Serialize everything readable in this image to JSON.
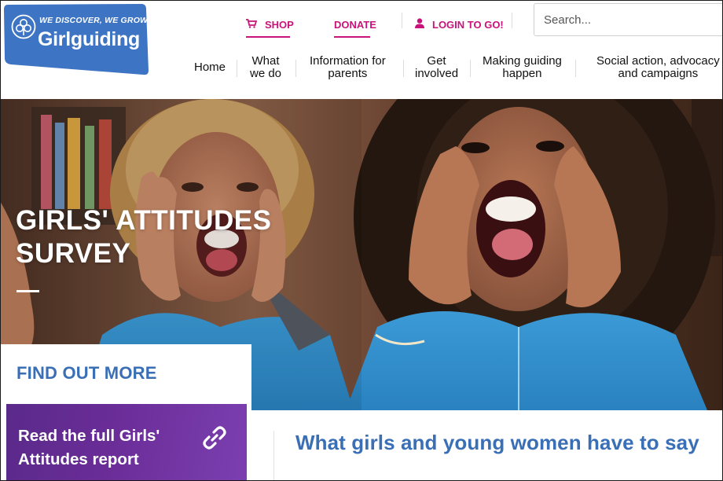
{
  "brand": {
    "tagline": "WE DISCOVER, WE GROW",
    "name": "Girlguiding",
    "color": "#3e74c4"
  },
  "utility_nav": {
    "shop_label": "SHOP",
    "donate_label": "DONATE",
    "login_label": "LOGIN TO GO!",
    "accent_color": "#c8137a",
    "shop_icon": "shopping-cart-icon",
    "login_icon": "user-icon"
  },
  "search": {
    "placeholder": "Search..."
  },
  "main_nav": [
    {
      "line1": "Home",
      "line2": ""
    },
    {
      "line1": "What",
      "line2": "we do"
    },
    {
      "line1": "Information for",
      "line2": "parents"
    },
    {
      "line1": "Get",
      "line2": "involved"
    },
    {
      "line1": "Making guiding",
      "line2": "happen"
    },
    {
      "line1": "Social action, advocacy",
      "line2": "and campaigns"
    }
  ],
  "hero": {
    "title_line1": "GIRLS' ATTITUDES",
    "title_line2": "SURVEY"
  },
  "find_out_more": {
    "heading": "FIND OUT MORE",
    "cta_line1": "Read the full Girls'",
    "cta_line2": "Attitudes report",
    "cta_icon": "link-icon"
  },
  "main": {
    "heading": "What girls and young women have to say",
    "heading_color": "#3a6fb6"
  }
}
